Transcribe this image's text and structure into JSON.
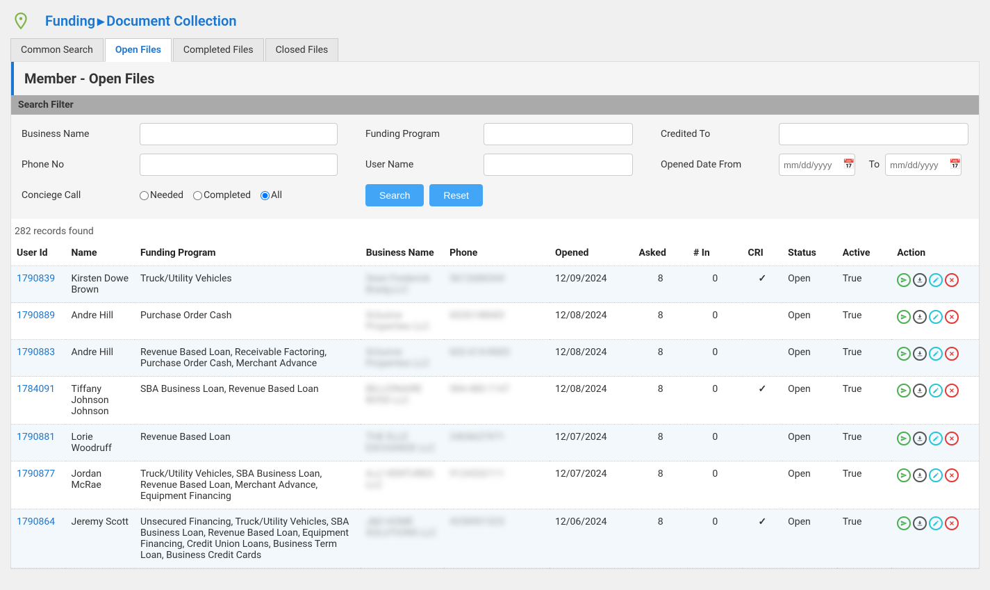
{
  "breadcrumb": {
    "parent": "Funding",
    "current": "Document Collection"
  },
  "tabs": [
    {
      "label": "Common Search",
      "active": false
    },
    {
      "label": "Open Files",
      "active": true
    },
    {
      "label": "Completed Files",
      "active": false
    },
    {
      "label": "Closed Files",
      "active": false
    }
  ],
  "page_title": "Member - Open Files",
  "filter": {
    "header": "Search Filter",
    "labels": {
      "business_name": "Business Name",
      "funding_program": "Funding Program",
      "credited_to": "Credited To",
      "phone_no": "Phone No",
      "user_name": "User Name",
      "opened_from": "Opened Date From",
      "to": "To",
      "conciege": "Conciege Call"
    },
    "radios": {
      "needed": "Needed",
      "completed": "Completed",
      "all": "All"
    },
    "buttons": {
      "search": "Search",
      "reset": "Reset"
    },
    "date_placeholder": "mm/dd/yyyy"
  },
  "records_found": "282 records found",
  "columns": {
    "user_id": "User Id",
    "name": "Name",
    "program": "Funding Program",
    "business": "Business Name",
    "phone": "Phone",
    "opened": "Opened",
    "asked": "Asked",
    "in": "# In",
    "cri": "CRI",
    "status": "Status",
    "active": "Active",
    "action": "Action"
  },
  "rows": [
    {
      "user_id": "1790839",
      "name": "Kirsten Dowe Brown",
      "program": "Truck/Utility Vehicles",
      "business": "Sean Frederick Brady,LLC",
      "phone": "5612686544",
      "opened": "12/09/2024",
      "asked": "8",
      "in": "0",
      "cri": "✓",
      "status": "Open",
      "active": "True"
    },
    {
      "user_id": "1790889",
      "name": "Andre Hill",
      "program": "Purchase Order Cash",
      "business": "Xclusive Properties LLC",
      "phone": "6026148683",
      "opened": "12/08/2024",
      "asked": "8",
      "in": "0",
      "cri": "",
      "status": "Open",
      "active": "True"
    },
    {
      "user_id": "1790883",
      "name": "Andre Hill",
      "program": "Revenue Based Loan, Receivable Factoring, Purchase Order Cash, Merchant Advance",
      "business": "Xclusive Properties LLC",
      "phone": "602-614-8683",
      "opened": "12/08/2024",
      "asked": "8",
      "in": "0",
      "cri": "",
      "status": "Open",
      "active": "True"
    },
    {
      "user_id": "1784091",
      "name": "Tiffany Johnson Johnson",
      "program": "SBA Business Loan, Revenue Based Loan",
      "business": "BILLIONAIRE BOSS LLC",
      "phone": "984-480-1147",
      "opened": "12/08/2024",
      "asked": "8",
      "in": "0",
      "cri": "✓",
      "status": "Open",
      "active": "True"
    },
    {
      "user_id": "1790881",
      "name": "Lorie Woodruff",
      "program": "Revenue Based Loan",
      "business": "THE ELLE EXCHANGE LLC",
      "phone": "2404637971",
      "opened": "12/07/2024",
      "asked": "8",
      "in": "0",
      "cri": "",
      "status": "Open",
      "active": "True"
    },
    {
      "user_id": "1790877",
      "name": "Jordan McRae",
      "program": "Truck/Utility Vehicles, SBA Business Loan, Revenue Based Loan, Merchant Advance, Equipment Financing",
      "business": "AJJ VENTURES LLC",
      "phone": "9124332111",
      "opened": "12/07/2024",
      "asked": "8",
      "in": "0",
      "cri": "",
      "status": "Open",
      "active": "True"
    },
    {
      "user_id": "1790864",
      "name": "Jeremy Scott",
      "program": "Unsecured Financing, Truck/Utility Vehicles, SBA Business Loan, Revenue Based Loan, Equipment Financing, Credit Union Loans, Business Term Loan, Business Credit Cards",
      "business": "J&S HOME SOLUTIONS LLC",
      "phone": "4258901523",
      "opened": "12/06/2024",
      "asked": "8",
      "in": "0",
      "cri": "✓",
      "status": "Open",
      "active": "True"
    }
  ]
}
